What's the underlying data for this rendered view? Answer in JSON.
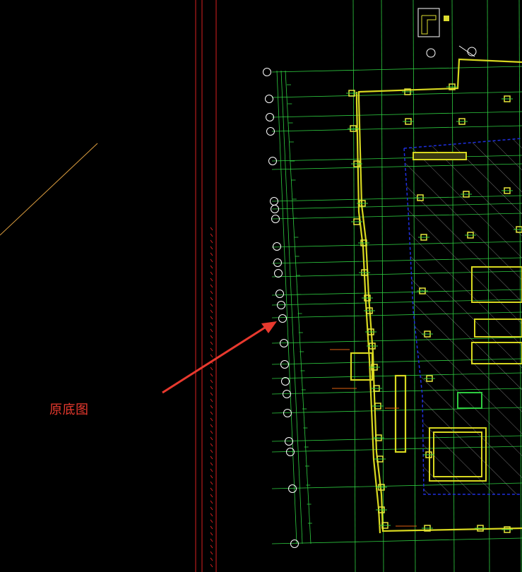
{
  "annotation": {
    "label": "原底图"
  },
  "colors": {
    "background": "#000000",
    "grid": "#2ecc40",
    "wall": "#d8d820",
    "column": "#e6e63a",
    "hatch_border": "#1f2fe0",
    "hatch": "#9a9a9a",
    "red_lines": "#d92020",
    "arrow": "#e8392e",
    "orange_line": "#e0a040",
    "bubble": "#ffffff",
    "dimension": "#e06010"
  },
  "icons": {
    "grid_bubble": "circle-axis-marker",
    "column": "square-column",
    "arrow": "red-pointer-arrow"
  }
}
